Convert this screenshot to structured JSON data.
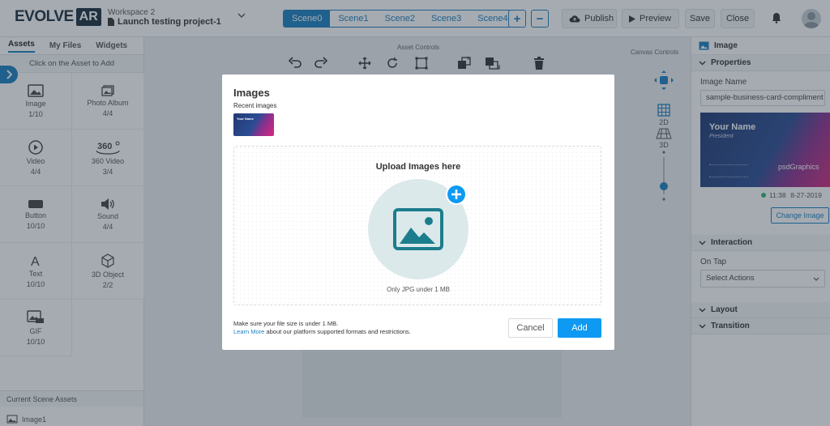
{
  "header": {
    "logo_main": "EVOLVE",
    "logo_badge": "AR",
    "workspace": "Workspace 2",
    "project": "Launch testing project-1",
    "scenes": [
      "Scene0",
      "Scene1",
      "Scene2",
      "Scene3",
      "Scene4"
    ],
    "active_scene": "Scene0",
    "add_scene": "+",
    "remove_scene": "−",
    "publish_label": "Publish",
    "preview_label": "Preview",
    "save_label": "Save",
    "close_label": "Close"
  },
  "left": {
    "tabs": [
      "Assets",
      "My Files",
      "Widgets"
    ],
    "active_tab": "Assets",
    "hint": "Click on the Asset to Add",
    "assets": [
      {
        "name": "Image",
        "count": "1/10",
        "icon": "image-icon"
      },
      {
        "name": "Photo Album",
        "count": "4/4",
        "icon": "photo-album-icon"
      },
      {
        "name": "Video",
        "count": "4/4",
        "icon": "video-icon"
      },
      {
        "name": "360 Video",
        "count": "3/4",
        "icon": "360-video-icon"
      },
      {
        "name": "Button",
        "count": "10/10",
        "icon": "button-icon"
      },
      {
        "name": "Sound",
        "count": "4/4",
        "icon": "sound-icon"
      },
      {
        "name": "Text",
        "count": "10/10",
        "icon": "text-icon"
      },
      {
        "name": "3D Object",
        "count": "2/2",
        "icon": "3d-object-icon"
      },
      {
        "name": "GIF",
        "count": "10/10",
        "icon": "gif-icon"
      }
    ],
    "current_scene_assets": "Current Scene Assets",
    "first_asset": "Image1"
  },
  "center": {
    "asset_controls": "Asset Controls",
    "canvas_controls": "Canvas Controls",
    "label_2d": "2D",
    "label_3d": "3D"
  },
  "right": {
    "panel_title": "Image",
    "properties": "Properties",
    "image_name_label": "Image Name",
    "image_name_value": "sample-business-card-compliment",
    "card_name": "Your Name",
    "card_title": "President",
    "card_logo": "psdGraphics",
    "time": "11:38",
    "date": "8-27-2019",
    "change_image": "Change Image",
    "interaction": "Interaction",
    "on_tap": "On Tap",
    "select_actions": "Select Actions",
    "layout": "Layout",
    "transition": "Transition"
  },
  "modal": {
    "title": "Images",
    "recent_label": "Recent images",
    "recent_card_text": "Your Name",
    "upload_title": "Upload Images here",
    "upload_note": "Only JPG under 1 MB",
    "footer_line1": "Make sure your file size is under 1 MB.",
    "learn_more": "Learn More",
    "footer_line2": "about our platform supported formats and restrictions.",
    "cancel_label": "Cancel",
    "add_label": "Add"
  },
  "colors": {
    "accent": "#1a7fc1",
    "add_button": "#0e9af3",
    "upload_circle": "#dbe9eb",
    "image_glyph": "#1c7d8c"
  }
}
